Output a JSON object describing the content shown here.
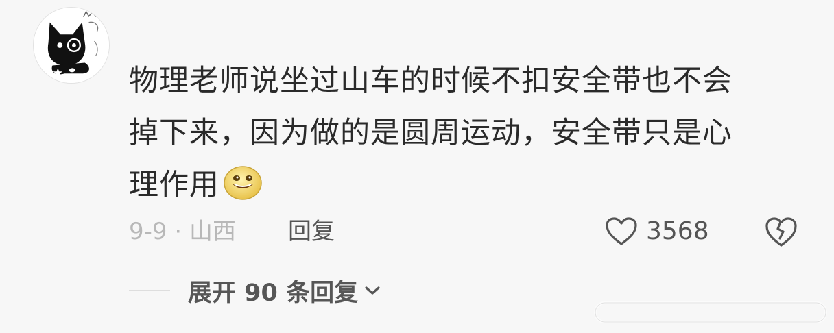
{
  "comment": {
    "lines": [
      "物理老师说坐过山车的时候不扣安全带也不会",
      "掉下来，因为做的是圆周运动，安全带只是心",
      "理作用"
    ],
    "emoji": "grin-emoji"
  },
  "meta": {
    "date_location": "9-9 · 山西",
    "reply_label": "回复",
    "like_count": "3568"
  },
  "replies": {
    "expand_label": "展开 90 条回复"
  },
  "colors": {
    "background": "#f7f7f7",
    "text": "#2a2a2a",
    "muted": "#b8b8b8",
    "action": "#555555"
  }
}
